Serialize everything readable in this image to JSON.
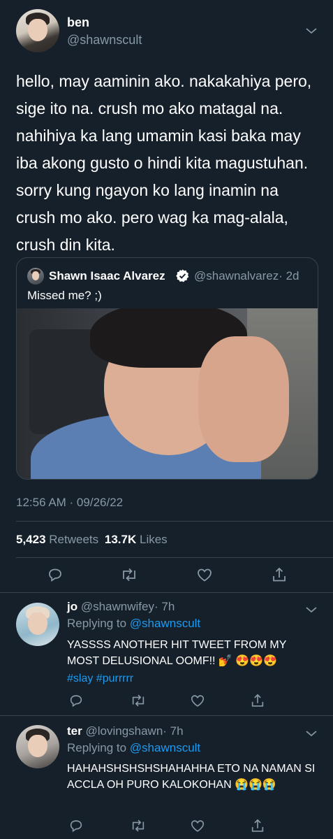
{
  "tweet": {
    "display_name": "ben",
    "handle": "@shawnscult",
    "body": "hello, may aaminin ako. nakakahiya pero, sige ito na. crush mo ako matagal na. nahihiya ka lang umamin kasi baka may iba akong gusto o hindi kita magustuhan. sorry kung ngayon ko lang inamin na crush mo ako. pero wag ka mag-alala, crush din kita.",
    "timestamp": "12:56 AM · 09/26/22",
    "retweets_count": "5,423",
    "retweets_label": "Retweets",
    "likes_count": "13.7K",
    "likes_label": "Likes"
  },
  "quoted": {
    "display_name": "Shawn Isaac Alvarez",
    "handle": "@shawnalvarez",
    "time": "· 2d",
    "text": "Missed me? ;)"
  },
  "replies": [
    {
      "name": "jo",
      "handle": "@shawnwifey",
      "time": "· 7h",
      "replying_prefix": "Replying to",
      "replying_to": "@shawnscult",
      "text": "YASSSS ANOTHER HIT TWEET FROM MY MOST DELUSIONAL OOMF!! 💅 😍😍😍",
      "hashtags": "#slay #purrrrr"
    },
    {
      "name": "ter",
      "handle": "@lovingshawn",
      "time": "· 7h",
      "replying_prefix": "Replying to",
      "replying_to": "@shawnscult",
      "text": "HAHAHSHSHSHSHAHAHHA ETO NA NAMAN SI ACCLA OH PURO KALOKOHAN 😭😭😭"
    }
  ],
  "colors": {
    "background": "#15202b",
    "secondary_text": "#8899a6",
    "link": "#1d9bf0",
    "divider": "#38444d"
  },
  "icons": [
    "chevron-down-icon",
    "verified-badge-icon",
    "reply-icon",
    "retweet-icon",
    "like-icon",
    "share-icon"
  ]
}
